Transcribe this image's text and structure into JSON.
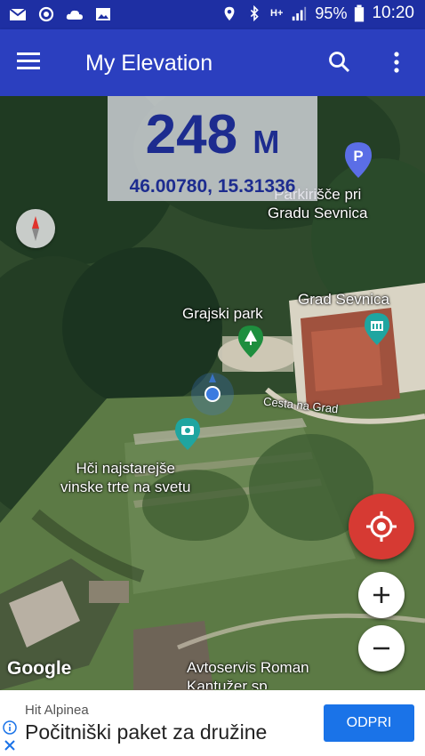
{
  "status_bar": {
    "battery": "95%",
    "time": "10:20",
    "network_type": "H+",
    "icons": [
      "mail-icon",
      "sync-icon",
      "cloud-icon",
      "image-icon",
      "location-icon",
      "bluetooth-icon",
      "signal-icon",
      "battery-icon"
    ]
  },
  "app_bar": {
    "title": "My Elevation",
    "icons": [
      "menu-icon",
      "search-icon",
      "more-vert-icon"
    ]
  },
  "elevation": {
    "value": "248",
    "unit": "M",
    "coordinates": "46.00780, 15.31336"
  },
  "map": {
    "labels": {
      "parking_line1": "Parkirišče pri",
      "parking_line2": "Gradu Sevnica",
      "castle": "Grad Sevnica",
      "park": "Grajski park",
      "road": "Cesta na Grad",
      "vine_line1": "Hči najstarejše",
      "vine_line2": "vinske trte na svetu",
      "service_line1": "Avtoservis Roman",
      "service_line2": "Kantužer sp"
    },
    "attribution": "Google",
    "colors": {
      "marker_blue": "#3b7be0",
      "poi_teal": "#1fa5a0",
      "park_green": "#1e8e3e",
      "parking_blue": "#5b6ee6"
    }
  },
  "ad": {
    "sponsor": "Hit Alpinea",
    "title": "Počitniški paket za družine",
    "button": "ODPRI"
  },
  "colors": {
    "status_bar": "#1e2fa3",
    "app_bar": "#2b3fbf",
    "location_fab": "#d63a33",
    "elevation_text": "#1d2c8f",
    "ad_button": "#1a73e8"
  }
}
